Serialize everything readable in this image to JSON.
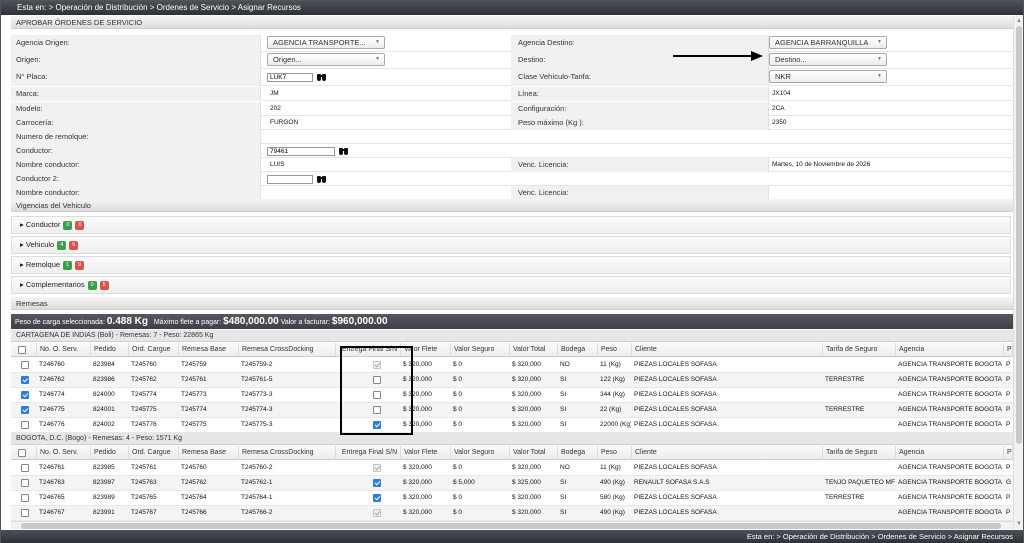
{
  "breadcrumb_top": "Esta en: > Operación de Distribución > Ordenes de Servicio > Asignar Recursos",
  "breadcrumb_bottom": "Esta en: > Operación de Distribución > Ordenes de Servicio > Asignar Recursos",
  "section_title": "APROBAR ÓRDENES DE SERVICIO",
  "form": {
    "agencia_origen_label": "Agencia Origen:",
    "agencia_origen_value": "AGENCIA TRANSPORTE...",
    "agencia_destino_label": "Agencia Destino:",
    "agencia_destino_value": "AGENCIA BARRANQUILLA",
    "origen_label": "Origen:",
    "origen_value": "Origen...",
    "destino_label": "Destino:",
    "destino_value": "Destino...",
    "placa_label": "N° Placa:",
    "placa_value": "LUK7",
    "clase_label": "Clase Vehículo-Tarifa:",
    "clase_value": "NKR",
    "marca_label": "Marca:",
    "marca_value": "JM",
    "linea_label": "Línea:",
    "linea_value": "JX104",
    "modelo_label": "Modelo:",
    "modelo_value": "202",
    "config_label": "Configuración:",
    "config_value": "2CA",
    "carroceria_label": "Carrocería:",
    "carroceria_value": "FURGON",
    "peso_label": "Peso máximo (Kg ):",
    "peso_value": "2350",
    "remolque_label": "Numero de remolque:",
    "conductor_label": "Conductor:",
    "conductor_value": "79461",
    "nombre_cond_label": "Nombre conductor:",
    "nombre_cond_value": "LUIS",
    "venc_label": "Venc. Licencia:",
    "venc_value": "Martes, 10 de Noviembre de 2026",
    "conductor2_label": "Conductor 2:",
    "conductor2_value": "",
    "nombre_cond2_label": "Nombre conductor:",
    "venc2_label": "Venc. Licencia:"
  },
  "vigencias": {
    "title": "Vigencias del Vehiculo",
    "items": [
      {
        "label": "Conductor",
        "green": "0",
        "red": "0"
      },
      {
        "label": "Vehiculo",
        "green": "4",
        "red": "6"
      },
      {
        "label": "Remolque",
        "green": "1",
        "red": "9"
      },
      {
        "label": "Complementarios",
        "green": "0",
        "red": "5"
      }
    ]
  },
  "remesas_title": "Remesas",
  "summary": {
    "peso_label": "Peso de carga seleccionada:",
    "peso_value": "0.488 Kg",
    "flete_label": "Máximo flete a pagar:",
    "flete_value": "$480,000.00",
    "facturar_label": "Valor a facturar:",
    "facturar_value": "$960,000.00"
  },
  "columns": [
    "",
    "No. O. Serv.",
    "Pedido",
    "Ord. Cargue",
    "Remesa Base",
    "Remesa CrossDocking",
    "Entrega Final S/N",
    "Valor Flete",
    "Valor Seguro",
    "Valor Total",
    "Bodega",
    "Peso",
    "Cliente",
    "Tarifa de Seguro",
    "Agencia",
    "P"
  ],
  "groups": [
    {
      "title": "CARTAGENA DE INDIAS (Boli) - Remesas: 7 - Peso: 22865 Kg",
      "rows": [
        {
          "sel": false,
          "os": "T246760",
          "ped": "823984",
          "oc": "T245760",
          "rb": "T245759",
          "rc": "T245759-2",
          "ef": "dis",
          "vf": "$ 320,000",
          "vs": "$ 0",
          "vt": "$ 320,000",
          "bod": "NO",
          "peso": "11 (Kg)",
          "cli": "PIEZAS LOCALES SOFASA",
          "tar": "",
          "ag": "AGENCIA TRANSPORTE BOGOTA",
          "p": "P"
        },
        {
          "sel": true,
          "os": "T246762",
          "ped": "823986",
          "oc": "T245762",
          "rb": "T245761",
          "rc": "T245761-5",
          "ef": "off",
          "vf": "$ 320,000",
          "vs": "$ 0",
          "vt": "$ 320,000",
          "bod": "SI",
          "peso": "122 (Kg)",
          "cli": "PIEZAS LOCALES SOFASA",
          "tar": "TERRESTRE",
          "ag": "AGENCIA TRANSPORTE BOGOTA",
          "p": "P"
        },
        {
          "sel": true,
          "os": "T246774",
          "ped": "824000",
          "oc": "T245774",
          "rb": "T245773",
          "rc": "T245773-3",
          "ef": "off",
          "vf": "$ 320,000",
          "vs": "$ 0",
          "vt": "$ 320,000",
          "bod": "SI",
          "peso": "344 (Kg)",
          "cli": "PIEZAS LOCALES SOFASA",
          "tar": "",
          "ag": "AGENCIA TRANSPORTE BOGOTA",
          "p": "P"
        },
        {
          "sel": true,
          "os": "T246775",
          "ped": "824001",
          "oc": "T245775",
          "rb": "T245774",
          "rc": "T245774-3",
          "ef": "off",
          "vf": "$ 320,000",
          "vs": "$ 0",
          "vt": "$ 320,000",
          "bod": "SI",
          "peso": "22 (Kg)",
          "cli": "PIEZAS LOCALES SOFASA",
          "tar": "TERRESTRE",
          "ag": "AGENCIA TRANSPORTE BOGOTA",
          "p": "P"
        },
        {
          "sel": false,
          "os": "T246776",
          "ped": "824002",
          "oc": "T245776",
          "rb": "T245775",
          "rc": "T245775-3",
          "ef": "on",
          "vf": "$ 320,000",
          "vs": "$ 0",
          "vt": "$ 320,000",
          "bod": "SI",
          "peso": "22000 (Kg)",
          "cli": "PIEZAS LOCALES SOFASA",
          "tar": "",
          "ag": "AGENCIA TRANSPORTE BOGOTA",
          "p": "P"
        }
      ]
    },
    {
      "title": "BOGOTA, D.C. (Bogo) - Remesas: 4 - Peso: 1571 Kg",
      "rows": [
        {
          "sel": false,
          "os": "T246761",
          "ped": "823985",
          "oc": "T245761",
          "rb": "T245760",
          "rc": "T245760-2",
          "ef": "dis",
          "vf": "$ 320,000",
          "vs": "$ 0",
          "vt": "$ 320,000",
          "bod": "NO",
          "peso": "11 (Kg)",
          "cli": "PIEZAS LOCALES SOFASA",
          "tar": "",
          "ag": "AGENCIA TRANSPORTE BOGOTA",
          "p": "P"
        },
        {
          "sel": false,
          "os": "T246763",
          "ped": "823987",
          "oc": "T245763",
          "rb": "T245762",
          "rc": "T245762-1",
          "ef": "on",
          "vf": "$ 320,000",
          "vs": "$ 5,000",
          "vt": "$ 325,000",
          "bod": "SI",
          "peso": "490 (Kg)",
          "cli": "RENAULT SOFASA S.A.S",
          "tar": "TENJO PAQUETEO MF",
          "ag": "AGENCIA TRANSPORTE BOGOTA",
          "p": "G"
        },
        {
          "sel": false,
          "os": "T246765",
          "ped": "823989",
          "oc": "T245765",
          "rb": "T245764",
          "rc": "T245764-1",
          "ef": "on",
          "vf": "$ 320,000",
          "vs": "$ 0",
          "vt": "$ 320,000",
          "bod": "SI",
          "peso": "580 (Kg)",
          "cli": "PIEZAS LOCALES SOFASA",
          "tar": "TERRESTRE",
          "ag": "AGENCIA TRANSPORTE BOGOTA",
          "p": "P"
        },
        {
          "sel": false,
          "os": "T246767",
          "ped": "823991",
          "oc": "T245767",
          "rb": "T245766",
          "rc": "T245766-2",
          "ef": "dis",
          "vf": "$ 320,000",
          "vs": "$ 0",
          "vt": "$ 320,000",
          "bod": "SI",
          "peso": "490 (Kg)",
          "cli": "PIEZAS LOCALES SOFASA",
          "tar": "",
          "ag": "AGENCIA TRANSPORTE BOGOTA",
          "p": "P"
        }
      ]
    }
  ]
}
